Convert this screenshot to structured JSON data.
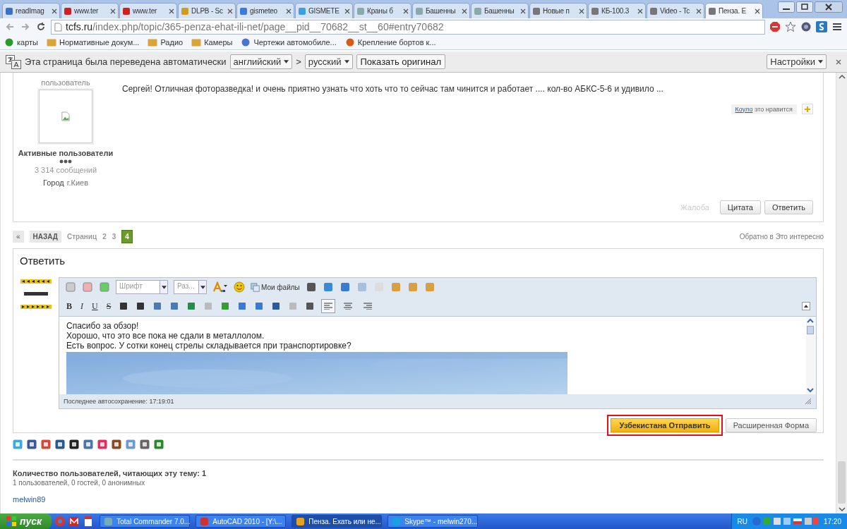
{
  "browser": {
    "tabs": [
      {
        "title": "readImag",
        "selected": false
      },
      {
        "title": "www.ter",
        "selected": false
      },
      {
        "title": "www.ter",
        "selected": false
      },
      {
        "title": "DLPB - Sc",
        "selected": false
      },
      {
        "title": "gismeteo",
        "selected": false
      },
      {
        "title": "GISMETE",
        "selected": false
      },
      {
        "title": "Краны б",
        "selected": false
      },
      {
        "title": "Башенны",
        "selected": false
      },
      {
        "title": "Башенны",
        "selected": false
      },
      {
        "title": "Новые п",
        "selected": false
      },
      {
        "title": "КБ-100.3",
        "selected": false
      },
      {
        "title": "Video - Tc",
        "selected": false
      },
      {
        "title": "Пенза. Е",
        "selected": true
      }
    ],
    "url_host": "tcfs.ru",
    "url_path": "/index.php/topic/365-penza-ehat-ili-net/page__pid__70682__st__60#entry70682",
    "bookmarks": [
      "карты",
      "Нормативные докум...",
      "Радио",
      "Камеры",
      "Чертежи автомобиле...",
      "Крепление бортов к..."
    ]
  },
  "translate_bar": {
    "message": "Эта страница была переведена автоматически",
    "from": "английский",
    "arrow": ">",
    "to": "русский",
    "show_original": "Показать оригинал",
    "settings": "Настройки"
  },
  "post": {
    "rank": "пользователь",
    "group": "Активные пользователи",
    "posts": "3 314 сообщений",
    "city_label": "Город",
    "city": "г.Киев",
    "text": "Сергей! Отличная фоторазведка! и очень приятно узнать что хоть что то сейчас там чинится и работает .... кол-во АБКС-5-6 и удивило ...",
    "like_user": "Коуло",
    "like_text": "это нравится",
    "report": "Жалоба",
    "quote": "Цитата",
    "reply": "Ответить"
  },
  "pagination": {
    "first": "«",
    "back": "НАЗАД",
    "label": "Страниц",
    "pages": [
      {
        "label": "2",
        "selected": false
      },
      {
        "label": "3",
        "selected": false
      },
      {
        "label": "4",
        "selected": true
      }
    ],
    "back_link": "Обратно в Это интересно"
  },
  "reply_form": {
    "title": "Ответить",
    "font_placeholder": "Шрифт",
    "size_placeholder": "Раз...",
    "my_files": "Мои файлы",
    "format_buttons": [
      "B",
      "I",
      "U",
      "S"
    ],
    "align_buttons": [
      {
        "selected": true
      },
      {
        "selected": false
      },
      {
        "selected": false
      }
    ],
    "lines": [
      "Спасибо за обзор!",
      "Хорошо, что это все пока не сдали в металлолом.",
      "Есть вопрос. У сотки конец стрелы складывается при транспортировке?"
    ],
    "autosave": "Последнее автосохранение: 17:19:01",
    "submit": "Узбекистана Отправить",
    "submit_highlighted": true,
    "advanced": "Расширенная Форма"
  },
  "readers": {
    "title": "Количество пользователей, читающих эту тему: 1",
    "summary": "1 пользователей, 0 гостей, 0 анонимных",
    "users": [
      "melwin89"
    ]
  },
  "taskbar": {
    "start": "пуск",
    "items": [
      {
        "title": "Total Commander 7.0...",
        "selected": false
      },
      {
        "title": "AutoCAD 2010 - [Y:\\...",
        "selected": false
      },
      {
        "title": "Пенза. Ехать или не...",
        "selected": true
      },
      {
        "title": "Skype™ - melwin270...",
        "selected": false
      }
    ],
    "language": "RU",
    "clock": "17:20"
  }
}
